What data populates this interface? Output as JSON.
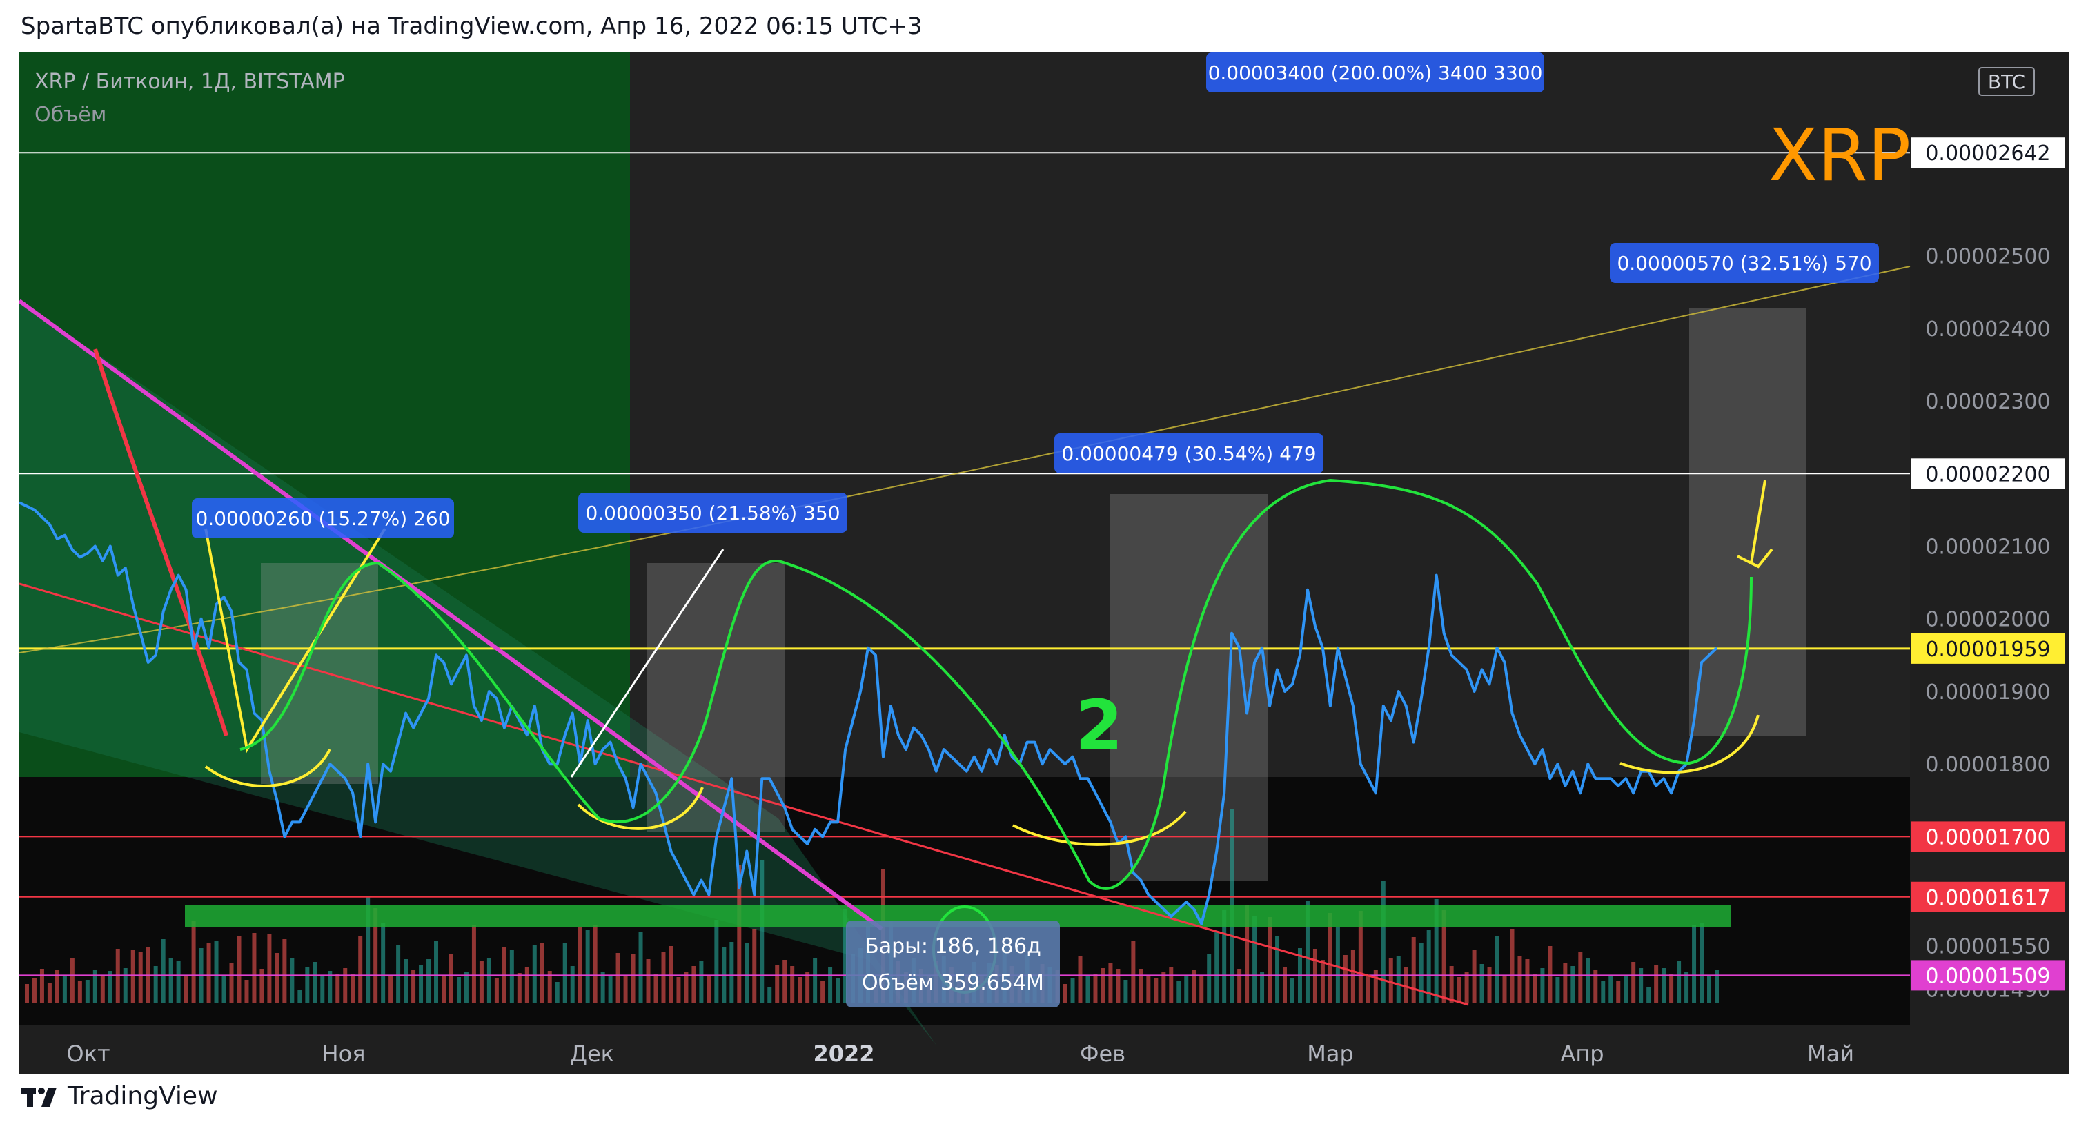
{
  "caption": "SpartaBTC опубликовал(а) на TradingView.com, Апр 16, 2022 06:15 UTC+3",
  "footer": {
    "brand": "TradingView"
  },
  "colors": {
    "background": "#1f1f1f",
    "green_zone": "#0a4e1a",
    "price_line": "#2f94f5",
    "support_red": "#f23645",
    "yellow": "#ffee32",
    "magenta": "#e040d0",
    "curve_green": "#22e33c",
    "label_blue": "#2962ff",
    "volume_up": "#26a69a",
    "volume_down": "#ef5350"
  },
  "chart_data": {
    "type": "line",
    "title": "XRP / Биткоин, 1Д, BITSTAMP",
    "subtitle": "Объём",
    "symbol_watermark": "XRP",
    "x_ticks": [
      "Окт",
      "Ноя",
      "Дек",
      "2022",
      "Фев",
      "Мар",
      "Апр",
      "Май"
    ],
    "y_ticks": [
      "0.00002500",
      "0.00002400",
      "0.00002300",
      "0.00002100",
      "0.00002000",
      "0.00001900",
      "0.00001800",
      "0.00001550",
      "0.00001490"
    ],
    "ylim": [
      1.44e-05,
      2.78e-05
    ],
    "currency_badge": "BTC",
    "price_levels": [
      {
        "value": 2.642e-05,
        "label": "0.00002642",
        "color": "#ffffff"
      },
      {
        "value": 2.2e-05,
        "label": "0.00002200",
        "color": "#ffffff"
      },
      {
        "value": 1.959e-05,
        "label": "0.00001959",
        "color": "#ffee32"
      },
      {
        "value": 1.7e-05,
        "label": "0.00001700",
        "color": "#f23645"
      },
      {
        "value": 1.617e-05,
        "label": "0.00001617",
        "color": "#f23645"
      },
      {
        "value": 1.509e-05,
        "label": "0.00001509",
        "color": "#e040d0"
      }
    ],
    "series": [
      {
        "values": [
          2160,
          2155,
          2150,
          2140,
          2130,
          2110,
          2115,
          2095,
          2085,
          2090,
          2100,
          2080,
          2100,
          2060,
          2070,
          2020,
          1980,
          1940,
          1950,
          2010,
          2040,
          2060,
          2040,
          1960,
          2000,
          1960,
          2020,
          2030,
          2010,
          1940,
          1930,
          1870,
          1860,
          1790,
          1750,
          1700,
          1720,
          1720,
          1740,
          1760,
          1780,
          1800,
          1790,
          1780,
          1760,
          1700,
          1800,
          1720,
          1800,
          1790,
          1830,
          1870,
          1850,
          1870,
          1890,
          1950,
          1940,
          1910,
          1930,
          1950,
          1880,
          1860,
          1900,
          1890,
          1850,
          1880,
          1860,
          1840,
          1880,
          1820,
          1800,
          1800,
          1840,
          1870,
          1800,
          1860,
          1800,
          1820,
          1830,
          1800,
          1780,
          1740,
          1800,
          1780,
          1760,
          1720,
          1680,
          1660,
          1640,
          1620,
          1640,
          1620,
          1700,
          1740,
          1780,
          1630,
          1680,
          1620,
          1780,
          1780,
          1760,
          1740,
          1710,
          1700,
          1690,
          1710,
          1700,
          1720,
          1720,
          1820,
          1860,
          1900,
          1960,
          1950,
          1810,
          1880,
          1840,
          1820,
          1850,
          1840,
          1820,
          1790,
          1820,
          1810,
          1800,
          1790,
          1810,
          1790,
          1820,
          1800,
          1840,
          1810,
          1800,
          1830,
          1830,
          1800,
          1820,
          1810,
          1800,
          1810,
          1780,
          1780,
          1760,
          1740,
          1720,
          1690,
          1700,
          1650,
          1640,
          1620,
          1610,
          1600,
          1590,
          1600,
          1610,
          1600,
          1580,
          1620,
          1680,
          1760,
          1980,
          1960,
          1870,
          1940,
          1960,
          1880,
          1930,
          1900,
          1910,
          1950,
          2040,
          1990,
          1960,
          1880,
          1960,
          1920,
          1880,
          1800,
          1780,
          1760,
          1880,
          1860,
          1900,
          1880,
          1830,
          1890,
          1960,
          2060,
          1980,
          1950,
          1940,
          1930,
          1900,
          1930,
          1910,
          1960,
          1940,
          1870,
          1840,
          1820,
          1800,
          1820,
          1780,
          1800,
          1770,
          1790,
          1760,
          1800,
          1780,
          1780,
          1780,
          1770,
          1780,
          1760,
          1790,
          1790,
          1770,
          1780,
          1760,
          1790,
          1800,
          1860,
          1940,
          1950,
          1960
        ]
      }
    ],
    "measures": [
      {
        "label": "0.00000260 (15.27%) 260"
      },
      {
        "label": "0.00000350 (21.58%) 350"
      },
      {
        "label": "0.00000479 (30.54%) 479"
      },
      {
        "label": "0.00003400 (200.00%) 3400  3300"
      },
      {
        "label": "0.00000570 (32.51%) 570"
      }
    ],
    "annotation": "2",
    "info_box": {
      "line1": "Бары: 186, 186д",
      "line2": "Объём 359.654M"
    }
  }
}
